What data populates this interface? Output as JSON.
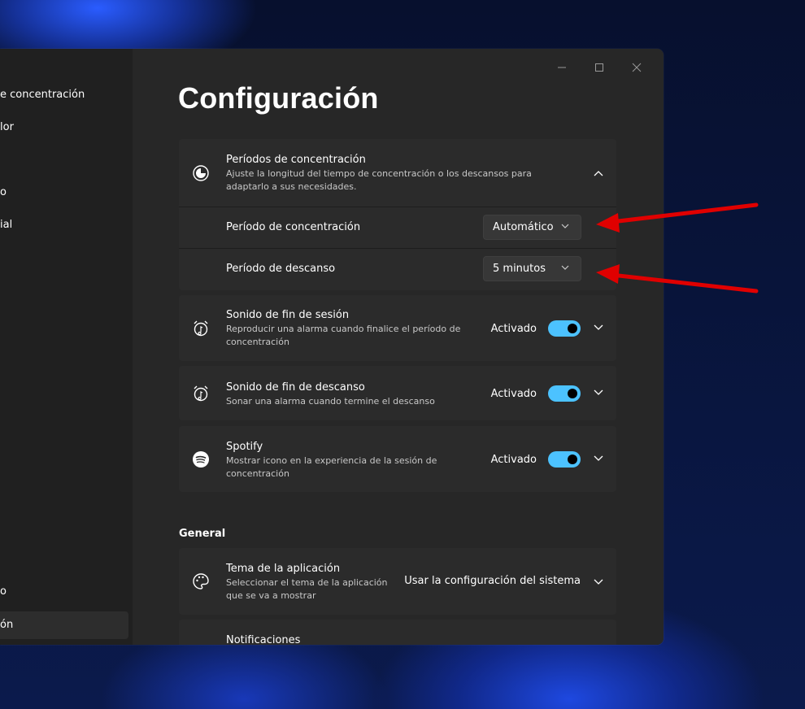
{
  "sidebar": {
    "items": [
      {
        "label": "e concentración"
      },
      {
        "label": "lor"
      },
      {
        "label": "o"
      },
      {
        "label": "ial"
      },
      {
        "label": "o"
      },
      {
        "label": "ón"
      }
    ]
  },
  "page": {
    "title": "Configuración"
  },
  "focus_periods": {
    "title": "Períodos de concentración",
    "description_line1": "Ajuste la longitud del tiempo de concentración o los descansos para",
    "description_line2": "adaptarlo a sus necesidades.",
    "focus_label": "Período de concentración",
    "focus_value": "Automático",
    "break_label": "Período de descanso",
    "break_value": "5 minutos"
  },
  "session_sound": {
    "title": "Sonido de fin de sesión",
    "description_line1": "Reproducir una alarma cuando finalice el período de",
    "description_line2": "concentración",
    "state": "Activado",
    "on": true
  },
  "break_sound": {
    "title": "Sonido de fin de descanso",
    "description_line1": "Sonar una alarma cuando termine el descanso",
    "state": "Activado",
    "on": true
  },
  "spotify": {
    "title": "Spotify",
    "description_line1": "Mostrar icono en la experiencia de la sesión de",
    "description_line2": "concentración",
    "state": "Activado",
    "on": true
  },
  "general": {
    "section_title": "General",
    "theme_title": "Tema de la aplicación",
    "theme_desc_line1": "Seleccionar el tema de la aplicación",
    "theme_desc_line2": "que se va a mostrar",
    "theme_value": "Usar la configuración del sistema",
    "notifications_title": "Notificaciones"
  },
  "colors": {
    "accent": "#4cc2ff",
    "annotation_arrow": "#e00000"
  }
}
